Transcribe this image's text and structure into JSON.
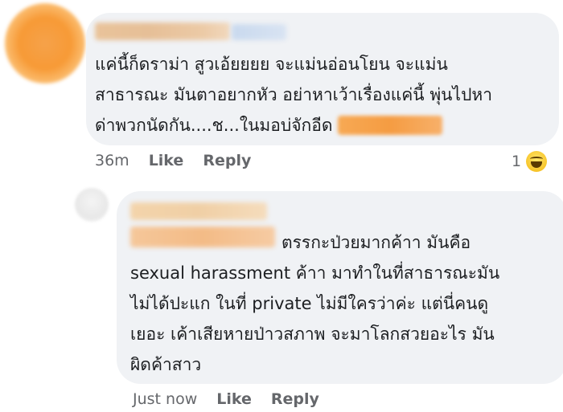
{
  "comments": [
    {
      "lines": [
        "แค่นี้ก็ดราม่า   สูวเอ้ยยยย จะแม่นอ่อนโยน จะแม่น",
        "สาธารณะ มันตาอยากหัว อย่าหาเว้าเรื่องแค่นี้ พุ่นไปหา",
        "ด่าพวกนัดกัน....ช...ในมอบ่จักอีด"
      ],
      "time": "36m",
      "like_label": "Like",
      "reply_label": "Reply",
      "reaction_count": "1",
      "reaction_icon": "haha-emoji-icon"
    },
    {
      "lines": [
        "ตรรกะป่วยมากค้าา มันคือ",
        "sexual harassment ค้าา มาทำในที่สาธารณะมัน",
        "ไม่ได้ปะแก ในที่ private ไม่มีใครว่าค่ะ แต่นี่คนดู",
        "เยอะ เค้าเสียหายป่าวสภาพ จะมาโลกสวยอะไร มัน",
        "ผิดค้าสาว"
      ],
      "time": "Just now",
      "like_label": "Like",
      "reply_label": "Reply"
    }
  ],
  "colors": {
    "bubble": "#f0f2f5",
    "text": "#1c1e21",
    "meta": "#65676b"
  }
}
